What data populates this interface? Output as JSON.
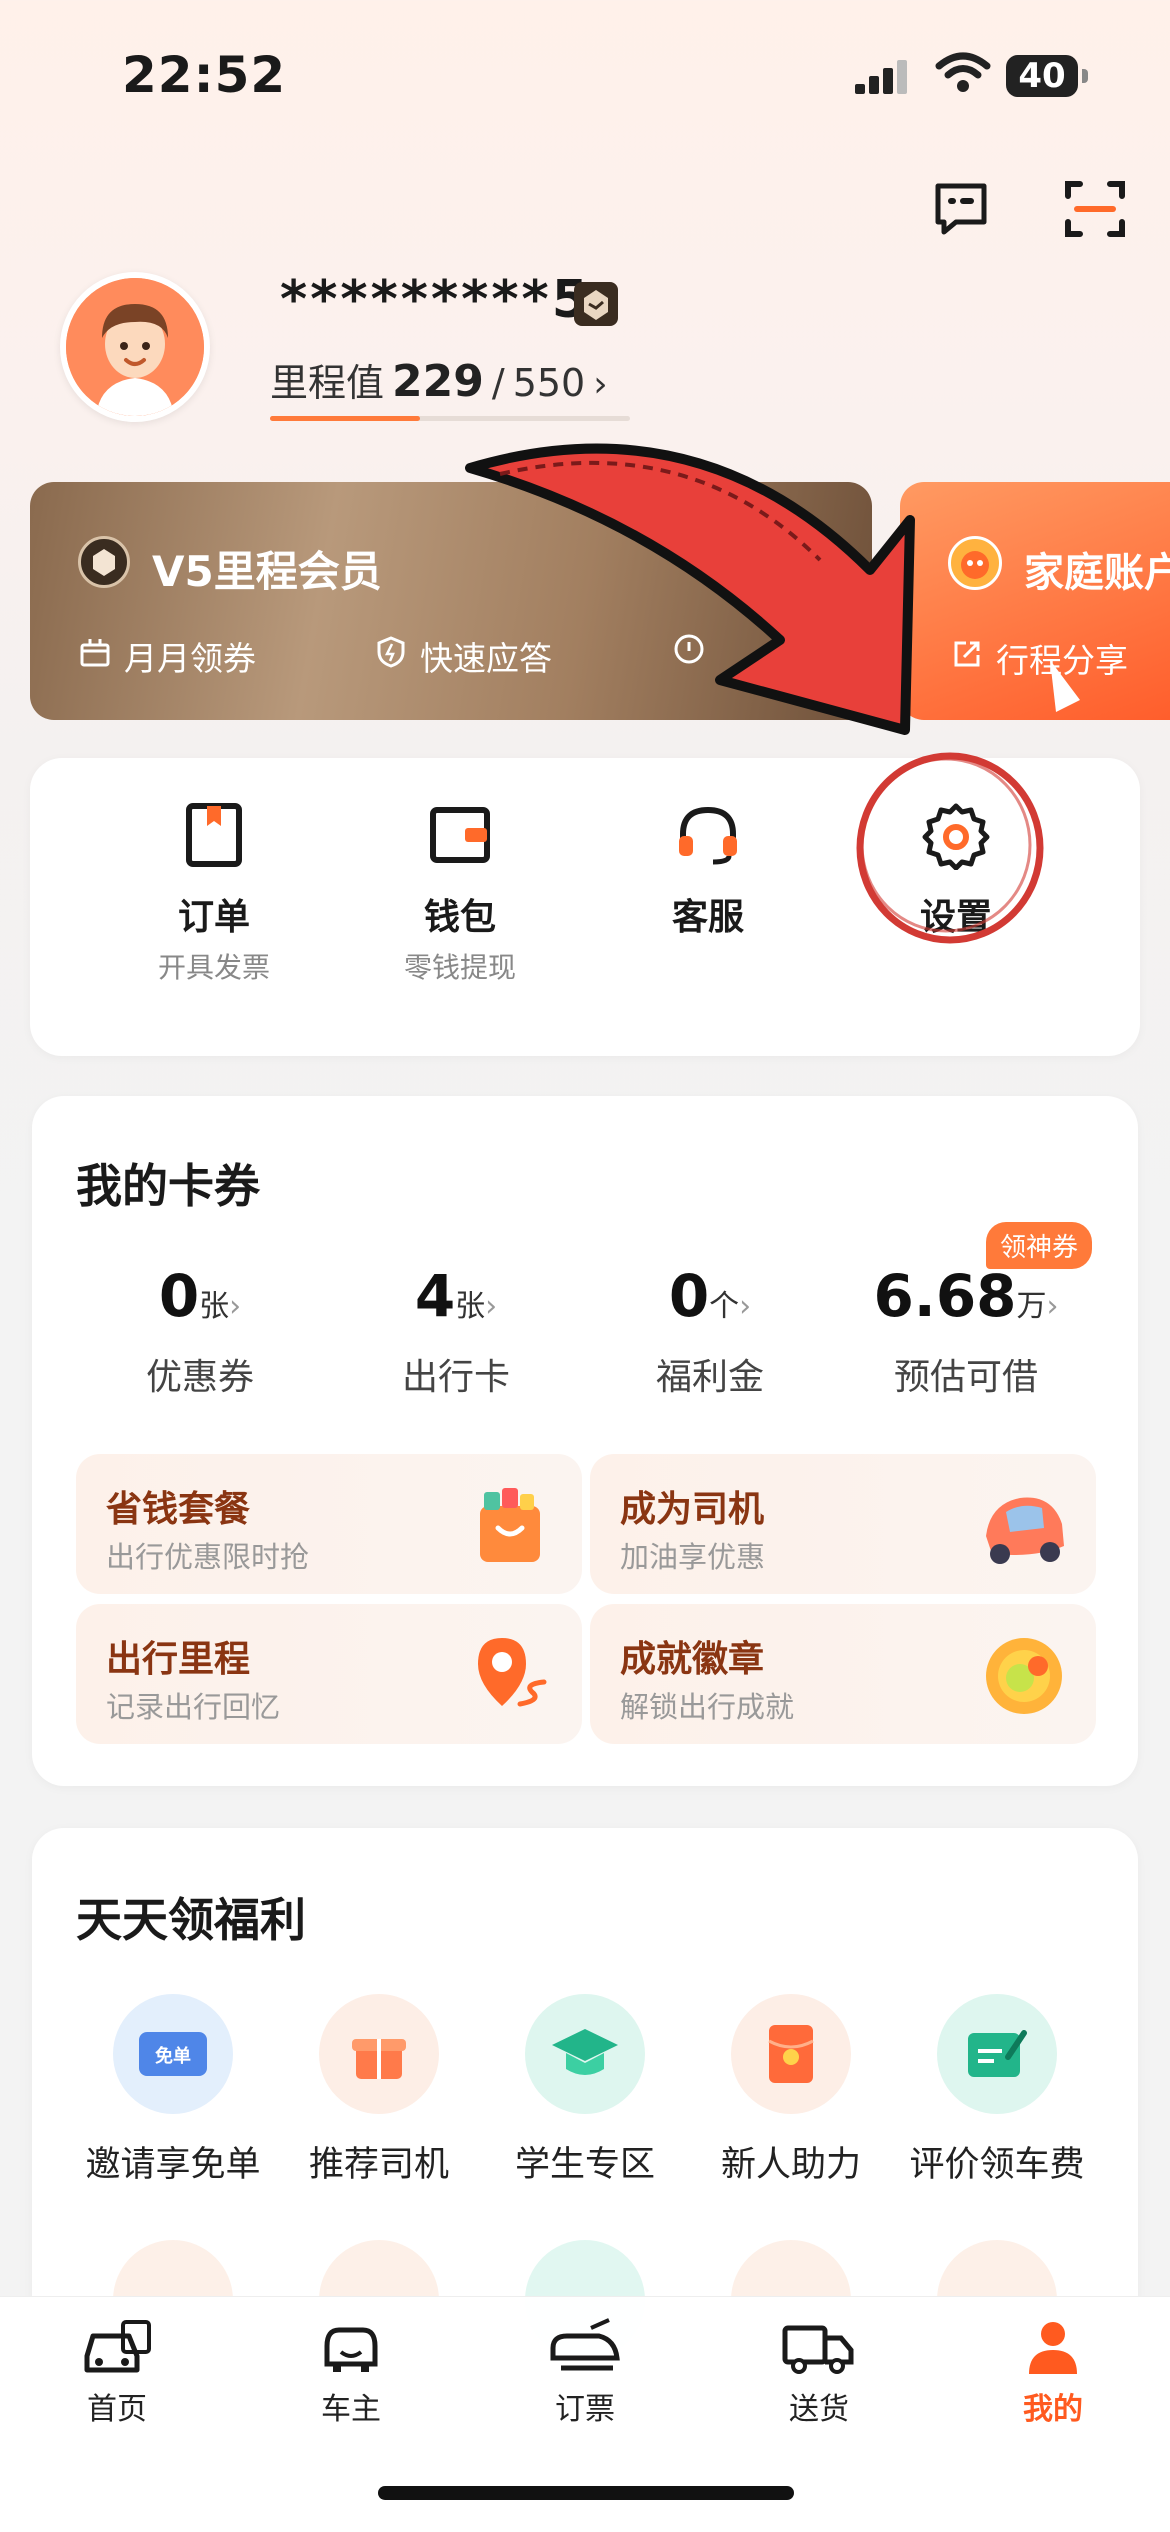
{
  "status_bar": {
    "time": "22:52",
    "battery": "40"
  },
  "profile": {
    "username": "*********5",
    "mileage_label": "里程值",
    "mileage_value": "229",
    "mileage_sep": "/",
    "mileage_max": "550",
    "mileage_progress": 0.416
  },
  "vip_card": {
    "title": "V5里程会员",
    "perks": [
      "月月领券",
      "快速应答"
    ]
  },
  "family_card": {
    "title": "家庭账户",
    "share": "行程分享"
  },
  "quick_actions": [
    {
      "label": "订单",
      "sub": "开具发票",
      "icon": "order-icon"
    },
    {
      "label": "钱包",
      "sub": "零钱提现",
      "icon": "wallet-icon"
    },
    {
      "label": "客服",
      "sub": "",
      "icon": "headset-icon"
    },
    {
      "label": "设置",
      "sub": "",
      "icon": "gear-icon"
    }
  ],
  "coupons": {
    "title": "我的卡券",
    "badge": "领神券",
    "stats": [
      {
        "value": "0",
        "unit": "张",
        "label": "优惠券"
      },
      {
        "value": "4",
        "unit": "张",
        "label": "出行卡"
      },
      {
        "value": "0",
        "unit": "个",
        "label": "福利金"
      },
      {
        "value": "6.68",
        "unit": "万",
        "label": "预估可借"
      }
    ],
    "promos": [
      {
        "title": "省钱套餐",
        "sub": "出行优惠限时抢",
        "icon": "shopping-bag-icon"
      },
      {
        "title": "成为司机",
        "sub": "加油享优惠",
        "icon": "car-icon"
      },
      {
        "title": "出行里程",
        "sub": "记录出行回忆",
        "icon": "location-pin-icon"
      },
      {
        "title": "成就徽章",
        "sub": "解锁出行成就",
        "icon": "medal-icon"
      }
    ]
  },
  "welfare": {
    "title": "天天领福利",
    "items": [
      {
        "label": "邀请享免单",
        "icon_text": "免单",
        "icon": "ticket-icon",
        "bg": "#e3effc"
      },
      {
        "label": "推荐司机",
        "icon": "gift-icon",
        "bg": "#fdeee6"
      },
      {
        "label": "学生专区",
        "icon": "graduation-cap-icon",
        "bg": "#def6ef"
      },
      {
        "label": "新人助力",
        "icon": "red-envelope-icon",
        "bg": "#fdeee6"
      },
      {
        "label": "评价领车费",
        "icon": "review-icon",
        "bg": "#def6ef"
      }
    ]
  },
  "tab_bar": {
    "tabs": [
      {
        "label": "首页",
        "icon": "car-home-icon",
        "active": false
      },
      {
        "label": "车主",
        "icon": "driver-icon",
        "active": false
      },
      {
        "label": "订票",
        "icon": "train-icon",
        "active": false
      },
      {
        "label": "送货",
        "icon": "truck-icon",
        "active": false
      },
      {
        "label": "我的",
        "icon": "person-icon",
        "active": true
      }
    ]
  },
  "colors": {
    "accent": "#ff7a3a",
    "annotation_red": "#e8403a",
    "active_tab": "#ff5a1f"
  }
}
